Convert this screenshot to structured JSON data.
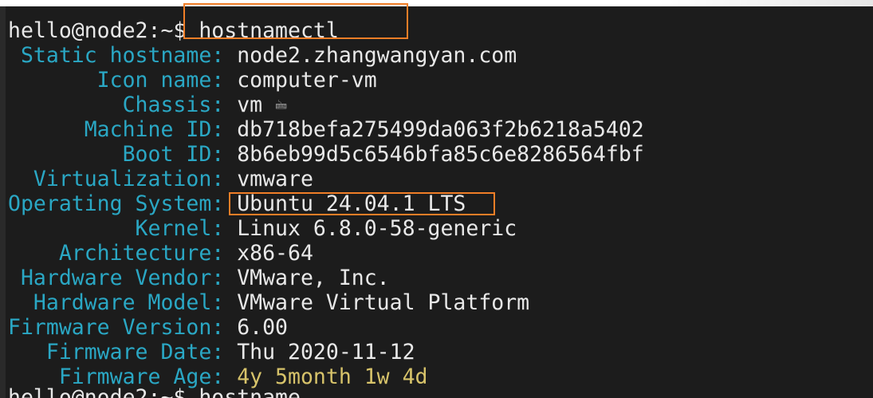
{
  "terminal": {
    "prompt": "hello@node2:~$ ",
    "command": "hostnamectl",
    "info": [
      {
        "key": " Static hostname: ",
        "value": "node2.zhangwangyan.com"
      },
      {
        "key": "       Icon name: ",
        "value": "computer-vm"
      },
      {
        "key": "         Chassis: ",
        "value": "vm"
      },
      {
        "key": "      Machine ID: ",
        "value": "db718befa275499da063f2b6218a5402"
      },
      {
        "key": "         Boot ID: ",
        "value": "8b6eb99d5c6546bfa85c6e8286564fbf"
      },
      {
        "key": "  Virtualization: ",
        "value": "vmware"
      },
      {
        "key": "Operating System: ",
        "value": "Ubuntu 24.04.1 LTS"
      },
      {
        "key": "          Kernel: ",
        "value": "Linux 6.8.0-58-generic"
      },
      {
        "key": "    Architecture: ",
        "value": "x86-64"
      },
      {
        "key": " Hardware Vendor: ",
        "value": "VMware, Inc."
      },
      {
        "key": "  Hardware Model: ",
        "value": "VMware Virtual Platform"
      },
      {
        "key": "Firmware Version: ",
        "value": "6.00"
      },
      {
        "key": "   Firmware Date: ",
        "value": "Thu 2020-11-12"
      },
      {
        "key": "    Firmware Age: ",
        "value": "4y 5month 1w 4d"
      }
    ],
    "next_prompt": "hello@node2:~$ ",
    "next_command": "hostname",
    "chassis_icon": "vm-chassis-icon",
    "colors": {
      "background": "#1c1c1c",
      "key": "#2aa7c4",
      "value": "#e8e8e8",
      "age": "#d7c36a",
      "highlight": "#f07e27"
    }
  }
}
